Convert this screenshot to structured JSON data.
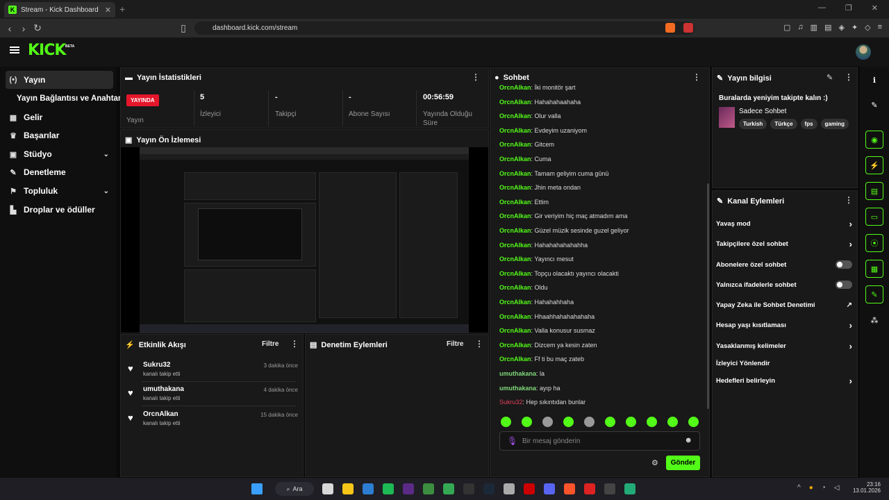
{
  "browser": {
    "tab_title": "Stream - Kick Dashboard",
    "tab_close": "✕",
    "new_tab": "+",
    "url": "dashboard.kick.com/stream"
  },
  "header": {
    "logo": "KICK",
    "beta": "BETA"
  },
  "sidebar": {
    "items": [
      {
        "label": "Yayın",
        "icon": "(•)",
        "active": true
      },
      {
        "label": "Yayın Bağlantısı ve Anahtarı",
        "icon": "",
        "sub": true
      },
      {
        "label": "Gelir",
        "icon": "▦"
      },
      {
        "label": "Başarılar",
        "icon": "♛"
      },
      {
        "label": "Stüdyo",
        "icon": "▣",
        "chevron": "⌄"
      },
      {
        "label": "Denetleme",
        "icon": "✎"
      },
      {
        "label": "Topluluk",
        "icon": "⚑",
        "chevron": "⌄"
      },
      {
        "label": "Droplar ve ödüller",
        "icon": "▙"
      }
    ]
  },
  "stats": {
    "title": "Yayın İstatistikleri",
    "live": "YAYINDA",
    "live_label": "Yayın",
    "viewers_value": "5",
    "viewers_label": "İzleyici",
    "followers_value": "-",
    "followers_label": "Takipçi",
    "subs_value": "-",
    "subs_label": "Abone Sayısı",
    "duration_value": "00:56:59",
    "duration_label": "Yayında Olduğu Süre"
  },
  "preview": {
    "title": "Yayın Ön İzlemesi"
  },
  "activity": {
    "title": "Etkinlik Akışı",
    "filter": "Filtre",
    "items": [
      {
        "user": "Sukru32",
        "action": "kanalı takip etti",
        "time": "3 dakika önce"
      },
      {
        "user": "umuthakana",
        "action": "kanalı takip etti",
        "time": "4 dakika önce"
      },
      {
        "user": "OrcnAlkan",
        "action": "kanalı takip etti",
        "time": "15 dakika önce"
      }
    ]
  },
  "moderation": {
    "title": "Denetim Eylemleri",
    "filter": "Filtre"
  },
  "chat": {
    "title": "Sohbet",
    "messages": [
      {
        "user": "OrcnAlkan",
        "text": ": İki monitör şart",
        "color": "green"
      },
      {
        "user": "OrcnAlkan",
        "text": ": Hahahahaahaha",
        "color": "green"
      },
      {
        "user": "OrcnAlkan",
        "text": ": Olur valla",
        "color": "green"
      },
      {
        "user": "OrcnAlkan",
        "text": ": Evdeyim uzaniyom",
        "color": "green"
      },
      {
        "user": "OrcnAlkan",
        "text": ": Gitcem",
        "color": "green"
      },
      {
        "user": "OrcnAlkan",
        "text": ": Cuma",
        "color": "green"
      },
      {
        "user": "OrcnAlkan",
        "text": ": Tamam geliyim cuma günü",
        "color": "green"
      },
      {
        "user": "OrcnAlkan",
        "text": ": Jhin meta ondan",
        "color": "green"
      },
      {
        "user": "OrcnAlkan",
        "text": ": Ettim",
        "color": "green"
      },
      {
        "user": "OrcnAlkan",
        "text": ": Gir veriyim hiç maç atmadım ama",
        "color": "green"
      },
      {
        "user": "OrcnAlkan",
        "text": ": Güzel müzik sesinde guzel geliyor",
        "color": "green"
      },
      {
        "user": "OrcnAlkan",
        "text": ": Hahahahahahahha",
        "color": "green"
      },
      {
        "user": "OrcnAlkan",
        "text": ": Yayıncı mesut",
        "color": "green"
      },
      {
        "user": "OrcnAlkan",
        "text": ": Topçu olacaktı yayıncı olacakti",
        "color": "green"
      },
      {
        "user": "OrcnAlkan",
        "text": ": Oldu",
        "color": "green"
      },
      {
        "user": "OrcnAlkan",
        "text": ": Hahahahhaha",
        "color": "green"
      },
      {
        "user": "OrcnAlkan",
        "text": ": Hhaahhahahahahaha",
        "color": "green"
      },
      {
        "user": "OrcnAlkan",
        "text": ": Valla konusur susmaz",
        "color": "green"
      },
      {
        "user": "OrcnAlkan",
        "text": ": Dizcem ya kesin zaten",
        "color": "green"
      },
      {
        "user": "OrcnAlkan",
        "text": ": Ff ti bu maç zateb",
        "color": "green"
      },
      {
        "user": "umuthakana",
        "text": ": la",
        "color": "lime"
      },
      {
        "user": "umuthakana",
        "text": ": ayıp ha",
        "color": "lime"
      },
      {
        "user": "Sukru32",
        "text": ": Hep sıkıntıdan bunlar",
        "color": "red"
      }
    ],
    "placeholder": "Bir mesaj gönderin",
    "send": "Gönder"
  },
  "stream_info": {
    "title": "Yayın bilgisi",
    "stream_title": "Buralarda yeniyim takipte kalın :)",
    "mode": "Sadece Sohbet",
    "tags": [
      "Turkish",
      "Türkçe",
      "fps",
      "gaming"
    ]
  },
  "channel_actions": {
    "title": "Kanal Eylemleri",
    "items": [
      {
        "label": "Yavaş mod",
        "control": "chevron"
      },
      {
        "label": "Takipçilere özel sohbet",
        "control": "chevron"
      },
      {
        "label": "Abonelere özel sohbet",
        "control": "toggle"
      },
      {
        "label": "Yalnızca ifadelerle sohbet",
        "control": "toggle"
      },
      {
        "label": "Yapay Zeka ile Sohbet Denetimi",
        "control": "external"
      },
      {
        "label": "Hesap yaşı kısıtlaması",
        "control": "chevron"
      },
      {
        "label": "Yasaklanmış kelimeler",
        "control": "chevron"
      },
      {
        "label": "İzleyici Yönlendir",
        "control": "none"
      },
      {
        "label": "Hedefleri belirleyin",
        "control": "chevron"
      }
    ]
  },
  "taskbar": {
    "search": "Ara",
    "time": "23:16",
    "date": "13.01.2026"
  },
  "colors": {
    "accent": "#53fc18",
    "live": "#e5162b",
    "bg": "#0a0a0a",
    "panel": "#191919"
  }
}
